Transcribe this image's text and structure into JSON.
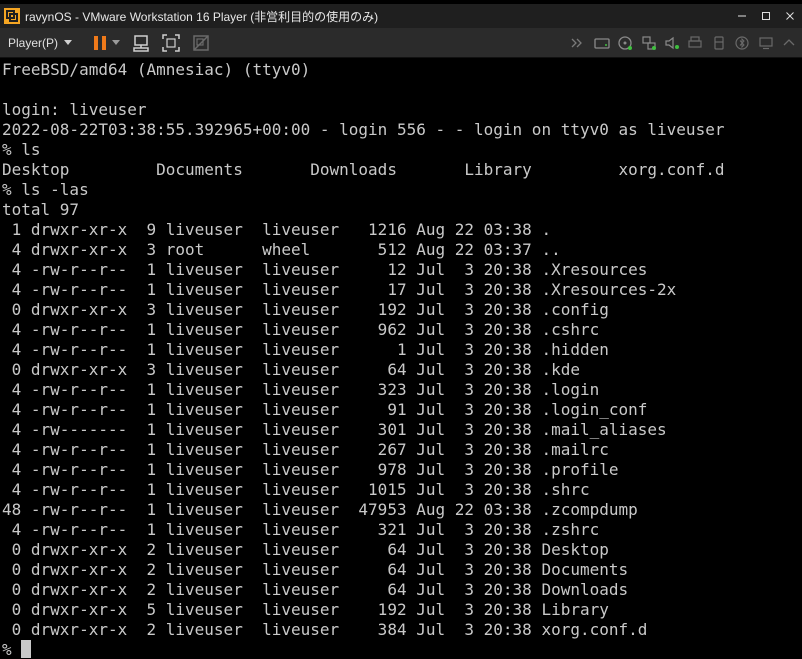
{
  "window": {
    "title": "ravynOS - VMware Workstation 16 Player (非営利目的の使用のみ)",
    "controls": [
      "minimize",
      "maximize",
      "close"
    ]
  },
  "toolbar": {
    "player_menu_label": "Player(P)",
    "buttons": [
      "pause",
      "pause-dropdown",
      "send-ctrl-alt-del",
      "full-screen",
      "unity"
    ],
    "device_icons": [
      "forward-arrows",
      "hard-disk",
      "cd-dvd",
      "network-adapter",
      "sound-card",
      "printer",
      "usb-device",
      "bluetooth",
      "display",
      "expand"
    ]
  },
  "terminal": {
    "lines": [
      "FreeBSD/amd64 (Amnesiac) (ttyv0)",
      "",
      "login: liveuser",
      "2022-08-22T03:38:55.392965+00:00 - login 556 - - login on ttyv0 as liveuser",
      "% ls",
      "Desktop         Documents       Downloads       Library         xorg.conf.d",
      "% ls -las",
      "total 97",
      " 1 drwxr-xr-x  9 liveuser  liveuser   1216 Aug 22 03:38 .",
      " 4 drwxr-xr-x  3 root      wheel       512 Aug 22 03:37 ..",
      " 4 -rw-r--r--  1 liveuser  liveuser     12 Jul  3 20:38 .Xresources",
      " 4 -rw-r--r--  1 liveuser  liveuser     17 Jul  3 20:38 .Xresources-2x",
      " 0 drwxr-xr-x  3 liveuser  liveuser    192 Jul  3 20:38 .config",
      " 4 -rw-r--r--  1 liveuser  liveuser    962 Jul  3 20:38 .cshrc",
      " 4 -rw-r--r--  1 liveuser  liveuser      1 Jul  3 20:38 .hidden",
      " 0 drwxr-xr-x  3 liveuser  liveuser     64 Jul  3 20:38 .kde",
      " 4 -rw-r--r--  1 liveuser  liveuser    323 Jul  3 20:38 .login",
      " 4 -rw-r--r--  1 liveuser  liveuser     91 Jul  3 20:38 .login_conf",
      " 4 -rw-------  1 liveuser  liveuser    301 Jul  3 20:38 .mail_aliases",
      " 4 -rw-r--r--  1 liveuser  liveuser    267 Jul  3 20:38 .mailrc",
      " 4 -rw-r--r--  1 liveuser  liveuser    978 Jul  3 20:38 .profile",
      " 4 -rw-r--r--  1 liveuser  liveuser   1015 Jul  3 20:38 .shrc",
      "48 -rw-r--r--  1 liveuser  liveuser  47953 Aug 22 03:38 .zcompdump",
      " 4 -rw-r--r--  1 liveuser  liveuser    321 Jul  3 20:38 .zshrc",
      " 0 drwxr-xr-x  2 liveuser  liveuser     64 Jul  3 20:38 Desktop",
      " 0 drwxr-xr-x  2 liveuser  liveuser     64 Jul  3 20:38 Documents",
      " 0 drwxr-xr-x  2 liveuser  liveuser     64 Jul  3 20:38 Downloads",
      " 0 drwxr-xr-x  5 liveuser  liveuser    192 Jul  3 20:38 Library",
      " 0 drwxr-xr-x  2 liveuser  liveuser    384 Jul  3 20:38 xorg.conf.d",
      "%"
    ]
  },
  "colors": {
    "terminal_bg": "#000000",
    "terminal_fg": "#c9c9c9",
    "titlebar_bg": "#1f1f1f",
    "toolbar_bg": "#2b2b2b",
    "pause_accent": "#f07a1a"
  }
}
